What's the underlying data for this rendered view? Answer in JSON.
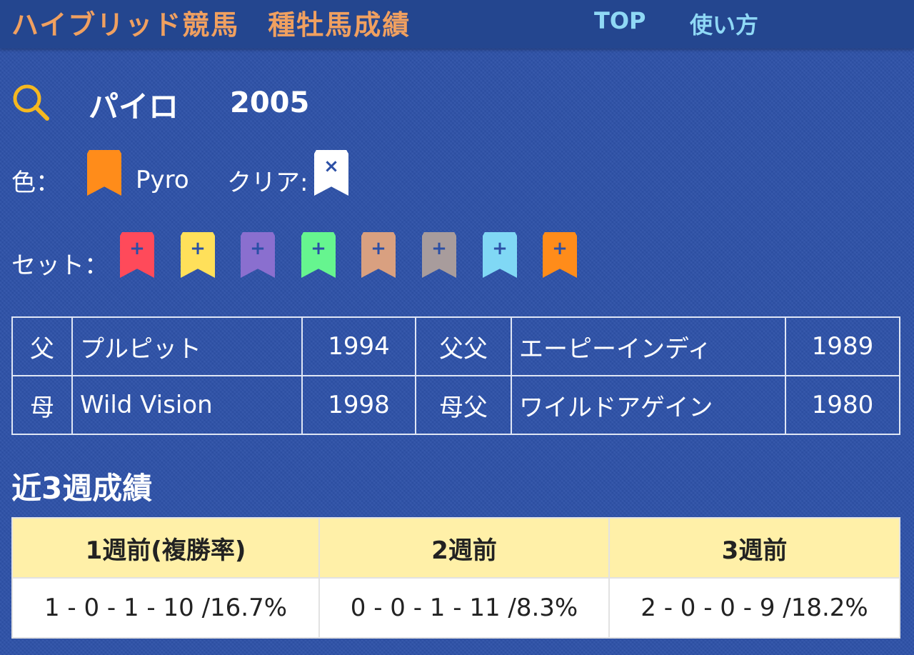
{
  "header": {
    "site_title": "ハイブリッド競馬　種牡馬成績",
    "nav": [
      {
        "label": "TOP"
      },
      {
        "label": "使い方"
      }
    ]
  },
  "horse": {
    "name": "パイロ",
    "year": "2005"
  },
  "color_row": {
    "label": "色：",
    "current_color_name": "Pyro",
    "current_color": "#ff8c1a",
    "clear_label": "クリア:",
    "clear_glyph": "×"
  },
  "set_row": {
    "label": "セット：",
    "glyph": "+",
    "colors": [
      "#ff4a5a",
      "#ffe05a",
      "#8a6fcf",
      "#66f58f",
      "#d9a080",
      "#a89c9c",
      "#80d8f5",
      "#ff8c1a"
    ]
  },
  "pedigree": [
    {
      "rel": "父",
      "name": "プルピット",
      "year": "1994",
      "rel2": "父父",
      "name2": "エーピーインディ",
      "year2": "1989"
    },
    {
      "rel": "母",
      "name": "Wild Vision",
      "year": "1998",
      "rel2": "母父",
      "name2": "ワイルドアゲイン",
      "year2": "1980"
    }
  ],
  "recent": {
    "title": "近3週成績",
    "headers": [
      "1週前(複勝率)",
      "2週前",
      "3週前"
    ],
    "values": [
      "1 - 0 - 1 - 10 /16.7%",
      "0 - 0 - 1 - 11 /8.3%",
      "2 - 0 - 0 - 9 /18.2%"
    ]
  }
}
